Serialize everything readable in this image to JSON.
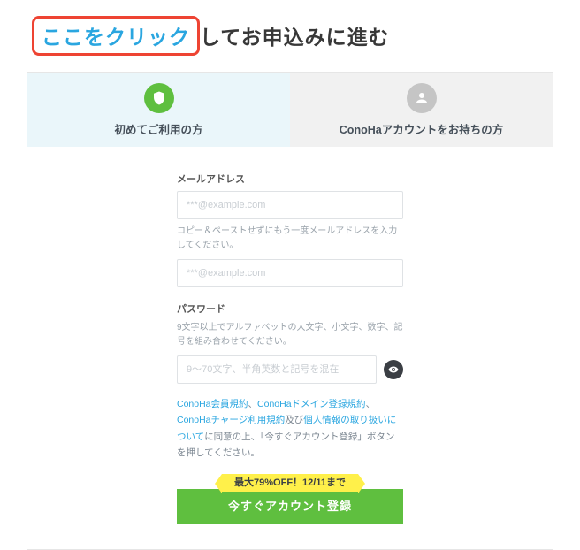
{
  "headline": {
    "click": "ここをクリック",
    "rest": "してお申込みに進む"
  },
  "tabs": {
    "first_time": "初めてご利用の方",
    "existing": "ConoHaアカウントをお持ちの方"
  },
  "form": {
    "email_label": "メールアドレス",
    "email_placeholder": "***@example.com",
    "email_hint": "コピー＆ペーストせずにもう一度メールアドレスを入力してください。",
    "email2_placeholder": "***@example.com",
    "password_label": "パスワード",
    "password_hint": "9文字以上でアルファベットの大文字、小文字、数字、記号を組み合わせてください。",
    "password_placeholder": "9〜70文字、半角英数と記号を混在"
  },
  "terms": {
    "link_members": "ConoHa会員規約",
    "sep1": "、",
    "link_domain": "ConoHaドメイン登録規約",
    "sep2": "、",
    "link_charge": "ConoHaチャージ利用規約",
    "mid": "及び",
    "link_privacy": "個人情報の取り扱いについて",
    "tail": "に同意の上、「今すぐアカウント登録」ボタンを押してください。"
  },
  "promo": "最大79%OFF！12/11まで",
  "cta": "今すぐアカウント登録"
}
